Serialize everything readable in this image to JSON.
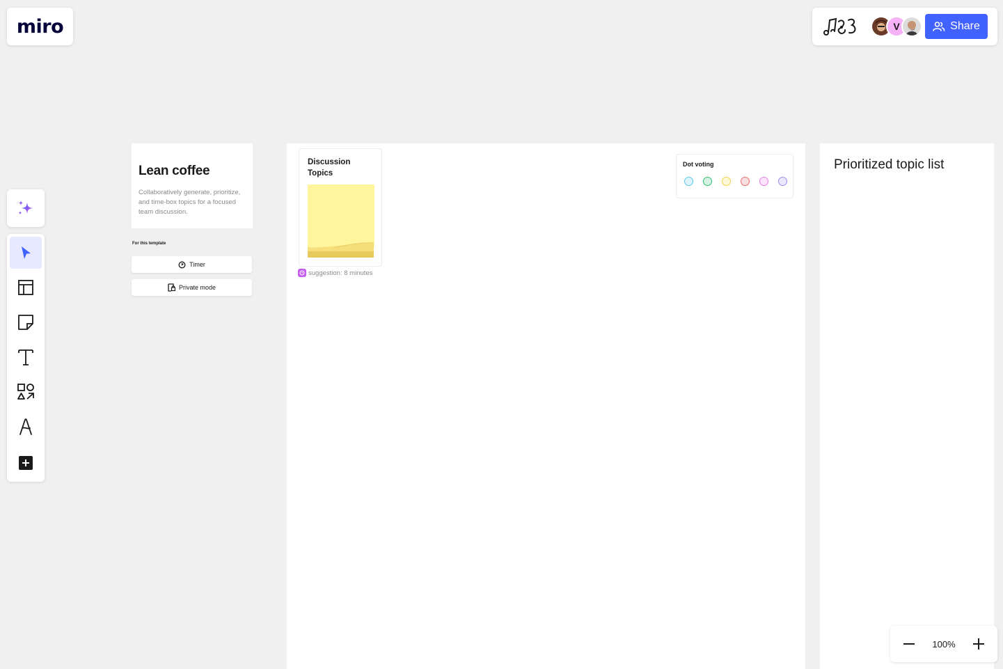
{
  "app": {
    "logo_text": "miro"
  },
  "topbar": {
    "share_label": "Share",
    "avatar_letter": "V",
    "colors": {
      "share_bg": "#4262ff",
      "avatar_v_bg": "#f7b2f7"
    }
  },
  "toolbar": {
    "ai_icon": "sparkles-icon",
    "tools": [
      "select-icon",
      "templates-icon",
      "sticky-note-icon",
      "text-icon",
      "shapes-icon",
      "pen-icon",
      "add-more-icon"
    ],
    "active_tool": "select-icon"
  },
  "lean_panel": {
    "title": "Lean coffee",
    "description": "Collaboratively generate, prioritize, and time-box topics for a focused team discussion.",
    "for_template_label": "For this template",
    "timer_label": "Timer",
    "private_mode_label": "Private mode"
  },
  "board": {
    "topics_title_line1": "Discussion",
    "topics_title_line2": "Topics",
    "suggestion_text": "suggestion: 8 minutes",
    "sticky_color": "#fff59d",
    "dot_voting_title": "Dot voting",
    "dot_colors": [
      "#5bc8e6",
      "#2fbf71",
      "#f5d547",
      "#e8686a",
      "#e57ce8",
      "#9a8cf0"
    ],
    "prioritized_title": "Prioritized topic list"
  },
  "zoom": {
    "level": "100%"
  }
}
